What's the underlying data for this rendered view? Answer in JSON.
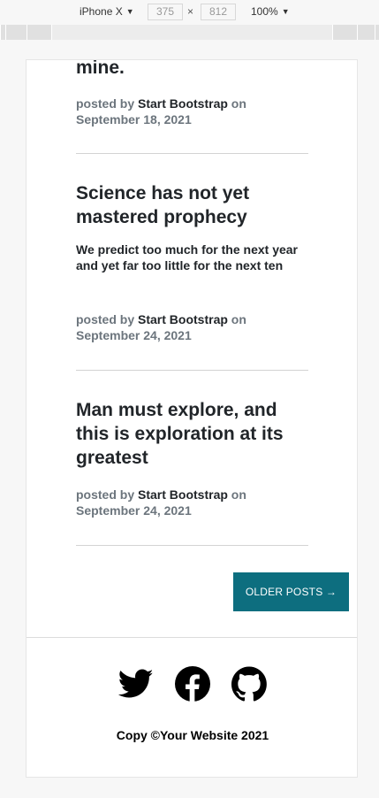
{
  "devtools": {
    "device": "iPhone X",
    "width": "375",
    "height": "812",
    "times": "×",
    "zoom": "100%"
  },
  "posts": [
    {
      "title": "mine.",
      "meta_prefix": "posted by ",
      "author": "Start Bootstrap",
      "meta_on": " on",
      "date": "September 18, 2021"
    },
    {
      "title": "Science has not yet mastered prophecy",
      "subtitle": "We predict too much for the next year and yet far too little for the next ten",
      "meta_prefix": "posted by ",
      "author": "Start Bootstrap",
      "meta_on": " on",
      "date": "September 24, 2021"
    },
    {
      "title": "Man must explore, and this is exploration at its greatest",
      "meta_prefix": "posted by ",
      "author": "Start Bootstrap",
      "meta_on": " on",
      "date": "September 24, 2021"
    }
  ],
  "pager": {
    "older_label": "OLDER POSTS →"
  },
  "footer": {
    "social_icons": [
      "twitter-icon",
      "facebook-icon",
      "github-icon"
    ],
    "copyright": "Copy ©Your Website 2021"
  },
  "colors": {
    "button": "#0d6e7f",
    "meta": "#6c757d",
    "text": "#212529"
  }
}
